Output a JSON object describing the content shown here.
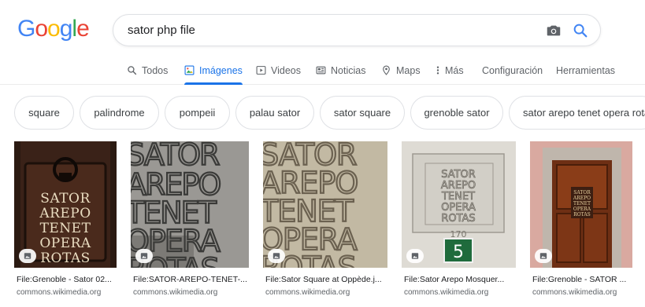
{
  "logo": {
    "text": "Google",
    "letters": [
      "G",
      "o",
      "o",
      "g",
      "l",
      "e"
    ],
    "colors": [
      "#4285f4",
      "#ea4335",
      "#fbbc05",
      "#4285f4",
      "#34a853",
      "#ea4335"
    ]
  },
  "search": {
    "query": "sator php file",
    "camera_icon": "camera-icon",
    "search_icon": "search-icon"
  },
  "tabs": [
    {
      "label": "Todos",
      "icon": "search-icon"
    },
    {
      "label": "Imágenes",
      "icon": "image-icon",
      "active": true
    },
    {
      "label": "Videos",
      "icon": "play-icon"
    },
    {
      "label": "Noticias",
      "icon": "newspaper-icon"
    },
    {
      "label": "Maps",
      "icon": "pin-icon"
    },
    {
      "label": "Más",
      "icon": "more-vert-icon"
    },
    {
      "label": "Configuración"
    },
    {
      "label": "Herramientas"
    }
  ],
  "chips": [
    "square",
    "palindrome",
    "pompeii",
    "palau sator",
    "sator square",
    "grenoble sator",
    "sator arepo tenet opera rotas"
  ],
  "results": [
    {
      "title": "File:Grenoble - Sator 02...",
      "source": "commons.wikimedia.org"
    },
    {
      "title": "File:SATOR-AREPO-TENET-...",
      "source": "commons.wikimedia.org"
    },
    {
      "title": "File:Sator Square at Oppède.j...",
      "source": "commons.wikimedia.org"
    },
    {
      "title": "File:Sator Arepo Mosquer...",
      "source": "commons.wikimedia.org"
    },
    {
      "title": "File:Grenoble - SATOR ...",
      "source": "commons.wikimedia.org"
    }
  ],
  "image_text": {
    "words": [
      "SATOR",
      "AREPO",
      "TENET",
      "OPERA",
      "ROTAS"
    ],
    "plate_number": "5",
    "small_year": "170"
  },
  "colors": {
    "accent": "#1a73e8",
    "text_secondary": "#5f6368",
    "border": "#dfe1e5"
  }
}
